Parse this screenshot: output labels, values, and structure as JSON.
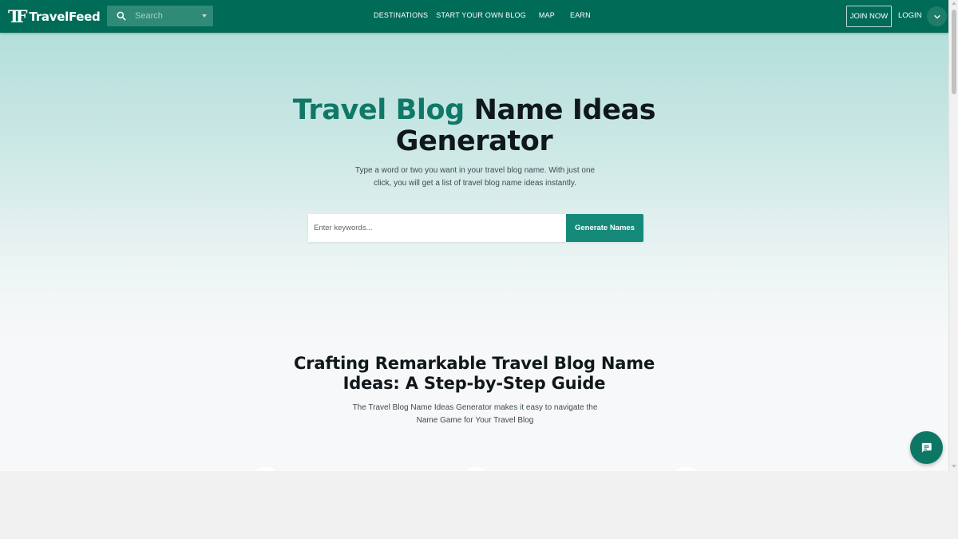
{
  "header": {
    "logo_mark": "TF",
    "logo_text": "TravelFeed",
    "search_placeholder": "Search",
    "nav": [
      "DESTINATIONS",
      "START YOUR OWN BLOG",
      "MAP",
      "EARN"
    ],
    "join_label": "JOIN NOW",
    "login_label": "LOGIN"
  },
  "hero": {
    "title_accent": "Travel Blog",
    "title_rest": "Name Ideas",
    "title_line2": "Generator",
    "subtitle_line1": "Type a word or two you want in your travel blog name. With just one",
    "subtitle_line2": "click, you will get a list of travel blog name ideas instantly.",
    "input_placeholder": "Enter keywords...",
    "button_label": "Generate Names"
  },
  "guide": {
    "title_line1": "Crafting Remarkable Travel Blog Name",
    "title_line2": "Ideas: A Step-by-Step Guide",
    "subtitle_line1": "The Travel Blog Name Ideas Generator makes it easy to navigate the",
    "subtitle_line2": "Name Game for Your Travel Blog"
  },
  "icons": {
    "search": "search-icon",
    "dropdown": "caret-down-icon",
    "account": "chevron-down-icon",
    "chat": "chat-icon"
  },
  "colors": {
    "header_bg": "#006b57",
    "accent": "#0f7868",
    "button": "#15897a"
  }
}
